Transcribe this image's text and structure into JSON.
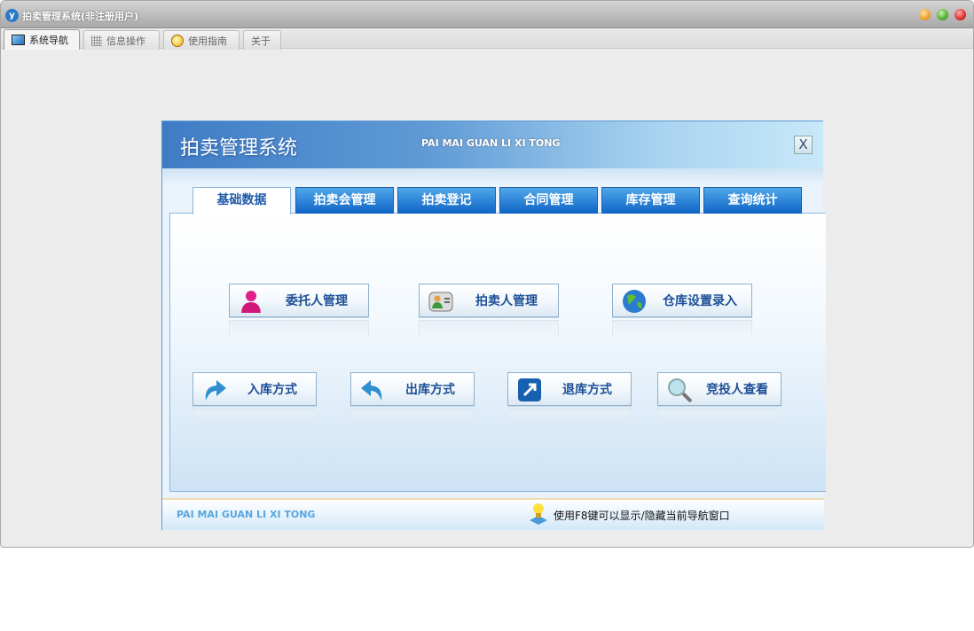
{
  "window": {
    "title": "拍卖管理系统(非注册用户)",
    "controls": {
      "minimize_color": "#f0a030",
      "maximize_color": "#50b030",
      "close_color": "#e02a2a"
    }
  },
  "app_tabs": [
    {
      "label": "系统导航",
      "icon": "monitor-icon"
    },
    {
      "label": "信息操作",
      "icon": "grid-icon"
    },
    {
      "label": "使用指南",
      "icon": "help-icon"
    },
    {
      "label": "关于"
    }
  ],
  "dialog": {
    "title": "拍卖管理系统",
    "subtitle": "PAI MAI GUAN LI XI TONG",
    "close": "X",
    "tabs": [
      "基础数据",
      "拍卖会管理",
      "拍卖登记",
      "合同管理",
      "库存管理",
      "查询统计"
    ],
    "active_tab": "基础数据",
    "buttons": [
      {
        "label": "委托人管理",
        "icon": "person-icon"
      },
      {
        "label": "拍卖人管理",
        "icon": "contact-card-icon"
      },
      {
        "label": "仓库设置录入",
        "icon": "globe-icon"
      },
      {
        "label": "入库方式",
        "icon": "arrow-forward-icon"
      },
      {
        "label": "出库方式",
        "icon": "arrow-back-icon"
      },
      {
        "label": "退库方式",
        "icon": "return-icon"
      },
      {
        "label": "竞投人查看",
        "icon": "magnifier-icon"
      }
    ],
    "footer": {
      "brand": "PAI MAI GUAN LI XI TONG",
      "tip": "使用F8键可以显示/隐藏当前导航窗口"
    }
  }
}
